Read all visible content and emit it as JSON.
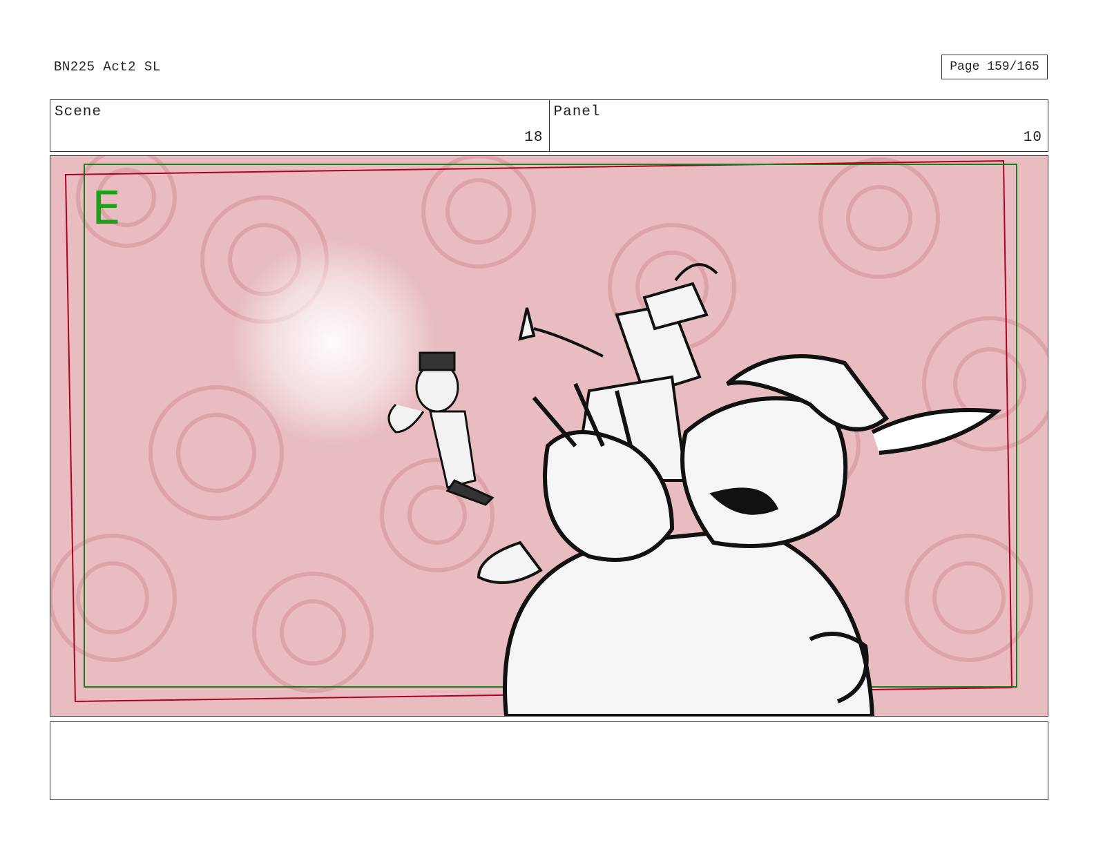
{
  "header": {
    "doc_title": "BN225 Act2 SL",
    "page_label": "Page 159/165"
  },
  "info": {
    "scene_label": "Scene",
    "scene_value": "18",
    "panel_label": "Panel",
    "panel_value": "10"
  },
  "frame": {
    "field_letter": "E",
    "safe_frame_color": "#1a7a1a",
    "camera_frame_color": "#b00020",
    "background_tint": "#e7b9bd"
  },
  "notes": {
    "text": ""
  }
}
